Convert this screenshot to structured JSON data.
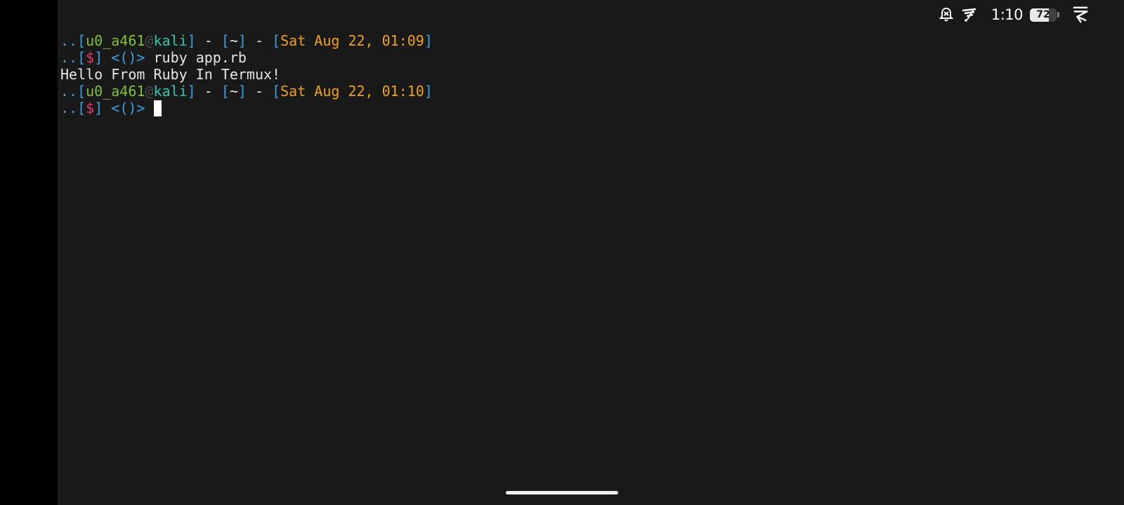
{
  "status_bar": {
    "time": "1:10",
    "battery_level": "72",
    "battery_fraction": 0.72,
    "icons": [
      "notification-muted-icon",
      "signal-icon",
      "termux-app-icon"
    ]
  },
  "prompt": {
    "dots": "..",
    "open_bracket": "[",
    "close_bracket": "]",
    "user": "u0_a461",
    "at": "@",
    "host": "kali",
    "separator": " - ",
    "dir": "~",
    "dollar": "$",
    "arrow": " <()> "
  },
  "terminal": {
    "lines": [
      {
        "kind": "header",
        "datetime": "Sat Aug 22, 01:09"
      },
      {
        "kind": "command",
        "command": "ruby app.rb"
      },
      {
        "kind": "output",
        "text": "Hello From Ruby In Termux!"
      },
      {
        "kind": "header",
        "datetime": "Sat Aug 22, 01:10"
      },
      {
        "kind": "command",
        "command": ""
      }
    ]
  },
  "colors": {
    "background": "#19191a",
    "prompt_blue": "#3aa0e4",
    "user_green": "#7ec23a",
    "host_cyan": "#34c6ad",
    "datetime_orange": "#f0a11c",
    "dollar_pink": "#e9336e"
  }
}
